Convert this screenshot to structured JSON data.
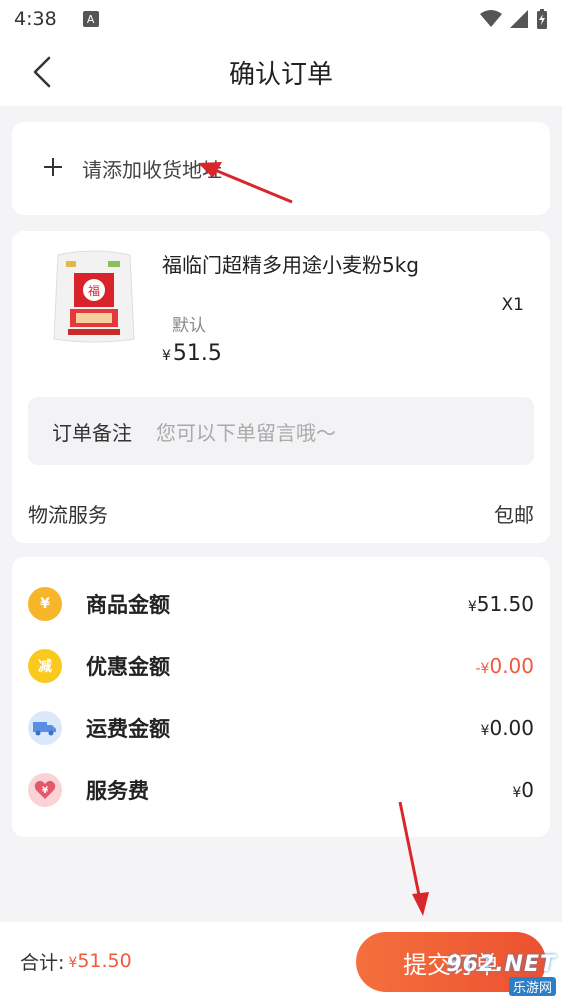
{
  "status_bar": {
    "time": "4:38",
    "badge": "A"
  },
  "nav": {
    "title": "确认订单"
  },
  "address": {
    "add_label": "请添加收货地址"
  },
  "product": {
    "name": "福临门超精多用途小麦粉5kg",
    "spec": "默认",
    "currency": "¥",
    "price": "51.5",
    "quantity": "X1"
  },
  "remark": {
    "label": "订单备注",
    "placeholder": "您可以下单留言哦～"
  },
  "logistics": {
    "label": "物流服务",
    "value": "包邮"
  },
  "summary": {
    "rows": [
      {
        "icon": "money-bag-icon",
        "icon_color": "#f7b529",
        "icon_text": "¥",
        "label": "商品金额",
        "currency": "¥",
        "value": "51.50"
      },
      {
        "icon": "discount-icon",
        "icon_color": "#f9c91e",
        "icon_text": "减",
        "label": "优惠金额",
        "currency": "-¥",
        "value": "0.00",
        "highlight": true
      },
      {
        "icon": "truck-icon",
        "icon_color": "#6fa4f2",
        "icon_text": "",
        "label": "运费金额",
        "currency": "¥",
        "value": "0.00"
      },
      {
        "icon": "heart-icon",
        "icon_color": "#fbd2d6",
        "icon_text": "¥",
        "label": "服务费",
        "currency": "¥",
        "value": "0"
      }
    ]
  },
  "footer": {
    "total_label": "合计:",
    "currency": "¥",
    "total_value": "51.50",
    "submit_label": "提交订单"
  },
  "watermark": {
    "top": "962.NET",
    "bottom": "乐游网"
  },
  "colors": {
    "accent": "#ef5a3c",
    "background": "#f4f4f6"
  }
}
